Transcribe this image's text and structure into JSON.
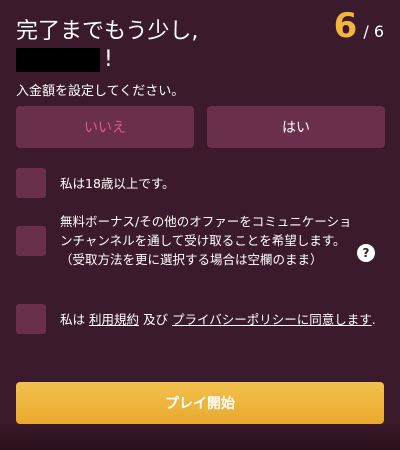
{
  "header": {
    "title_line1": "完了までもう少し,",
    "title_line2_suffix": "!",
    "step_current": "6",
    "step_separator_total": "/ 6"
  },
  "deposit": {
    "prompt": "入金額を設定してください。",
    "no_label": "いいえ",
    "yes_label": "はい"
  },
  "checks": {
    "age_label": "私は18歳以上です。",
    "marketing_label": "無料ボーナス/その他のオファーをコミュニケーションチャンネルを通して受け取ることを希望します。（受取方法を更に選択する場合は空欄のまま）",
    "help_symbol": "?",
    "terms_prefix": "私は",
    "terms_link": "利用規約",
    "terms_and": "及び",
    "privacy_link": "プライバシーポリシーに同意します",
    "terms_suffix": "."
  },
  "actions": {
    "play_label": "プレイ開始"
  },
  "colors": {
    "background": "#3b1a2b",
    "control": "#6a2f4a",
    "accent": "#f2b63c",
    "no_text": "#e0559a"
  }
}
